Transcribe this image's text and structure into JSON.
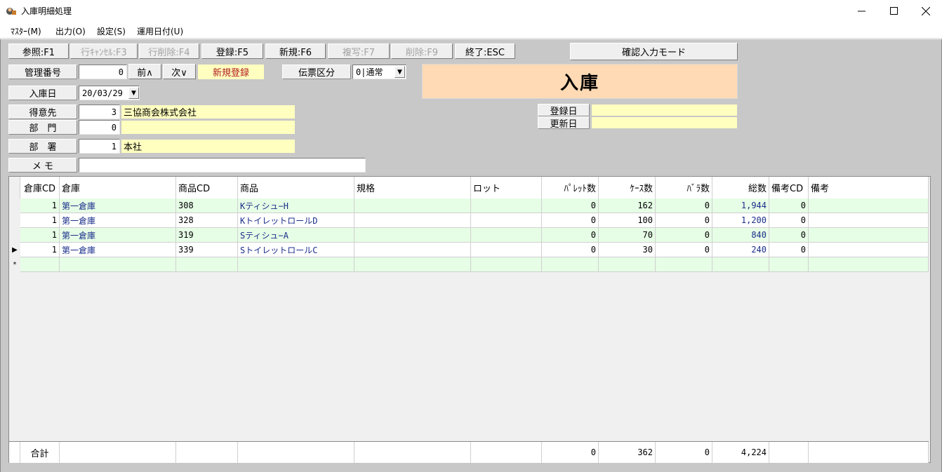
{
  "window": {
    "title": "入庫明細処理"
  },
  "menu": [
    "ﾏｽﾀｰ(M)",
    "出力(O)",
    "設定(S)",
    "運用日付(U)"
  ],
  "toolbar": {
    "buttons": [
      {
        "label": "参照:F1",
        "enabled": true
      },
      {
        "label": "行ｷｬﾝｾﾙ:F3",
        "enabled": false
      },
      {
        "label": "行削除:F4",
        "enabled": false
      },
      {
        "label": "登録:F5",
        "enabled": true
      },
      {
        "label": "新規:F6",
        "enabled": true
      },
      {
        "label": "複写:F7",
        "enabled": false
      },
      {
        "label": "削除:F9",
        "enabled": false
      },
      {
        "label": "終了:ESC",
        "enabled": true
      }
    ],
    "mode_label": "確認入力モード"
  },
  "header": {
    "kanri_label": "管理番号",
    "kanri_value": "0",
    "prev_label": "前∧",
    "next_label": "次∨",
    "status": "新規登録",
    "denpyo_label": "伝票区分",
    "denpyo_value": "0|通常",
    "banner": "入庫",
    "date_label": "入庫日",
    "date_value": "20/03/29",
    "customer_label": "得意先",
    "customer_code": "3",
    "customer_name": "三協商会株式会社",
    "dept_label": "部　門",
    "dept_code": "0",
    "dept_name": "",
    "section_label": "部　署",
    "section_code": "1",
    "section_name": "本社",
    "memo_label": "メ モ",
    "memo_value": "",
    "registered_label": "登録日",
    "registered_value": "",
    "updated_label": "更新日",
    "updated_value": ""
  },
  "grid": {
    "columns": [
      "倉庫CD",
      "倉庫",
      "商品CD",
      "商品",
      "規格",
      "ロット",
      "ﾊﾟﾚｯﾄ数",
      "ｹｰｽ数",
      "ﾊﾞﾗ数",
      "総数",
      "備考CD",
      "備考"
    ],
    "rows": [
      {
        "wh_cd": "1",
        "wh": "第一倉庫",
        "item_cd": "308",
        "item": "Kティシュ−H",
        "spec": "",
        "lot": "",
        "pallet": "0",
        "case": "162",
        "bara": "0",
        "total": "1,944",
        "note_cd": "0",
        "note": ""
      },
      {
        "wh_cd": "1",
        "wh": "第一倉庫",
        "item_cd": "328",
        "item": "KトイレットロールD",
        "spec": "",
        "lot": "",
        "pallet": "0",
        "case": "100",
        "bara": "0",
        "total": "1,200",
        "note_cd": "0",
        "note": ""
      },
      {
        "wh_cd": "1",
        "wh": "第一倉庫",
        "item_cd": "319",
        "item": "Sティシュ−A",
        "spec": "",
        "lot": "",
        "pallet": "0",
        "case": "70",
        "bara": "0",
        "total": "840",
        "note_cd": "0",
        "note": ""
      },
      {
        "wh_cd": "1",
        "wh": "第一倉庫",
        "item_cd": "339",
        "item": "SトイレットロールC",
        "spec": "",
        "lot": "",
        "pallet": "0",
        "case": "30",
        "bara": "0",
        "total": "240",
        "note_cd": "0",
        "note": ""
      }
    ],
    "new_row_marker": "*",
    "current_row_marker": "▶",
    "current_row_index": 3,
    "totals": {
      "label": "合計",
      "pallet": "0",
      "case": "362",
      "bara": "0",
      "total": "4,224"
    }
  },
  "colors": {
    "row_green": "#e6fde6",
    "row_white": "#ffffff",
    "status_yellow": "#ffffc0",
    "banner_peach": "#ffdab4"
  }
}
